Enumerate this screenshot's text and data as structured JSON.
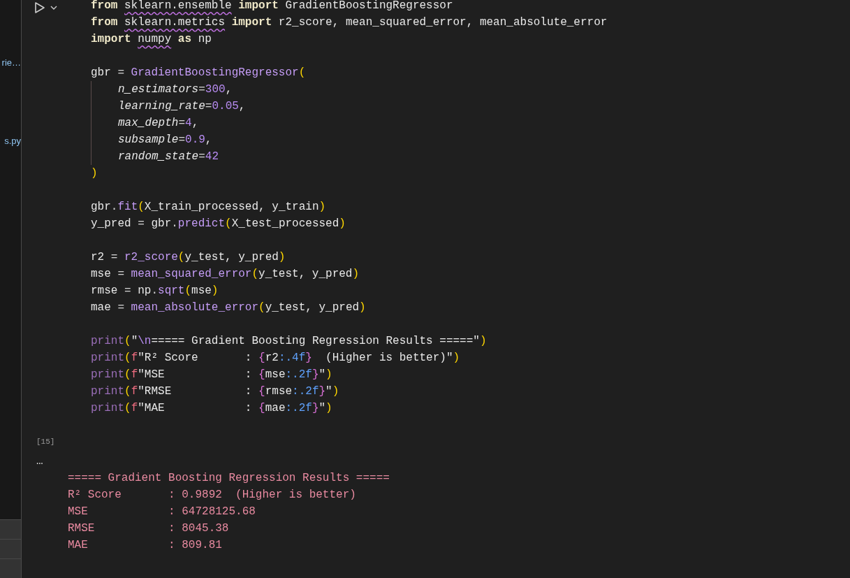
{
  "sidebar": {
    "items": [
      {
        "label": "rie…"
      },
      {
        "label": "s.py"
      }
    ]
  },
  "cell": {
    "code_blocks": [
      [
        {
          "indented": false,
          "tokens": [
            {
              "kind": "kw",
              "text": "from "
            },
            {
              "kind": "modw",
              "text": "sklearn.ensemble"
            },
            {
              "kind": "kw",
              "text": " import"
            },
            {
              "kind": "plain",
              "text": " GradientBoostingRegressor"
            }
          ]
        },
        {
          "indented": false,
          "tokens": [
            {
              "kind": "kw",
              "text": "from "
            },
            {
              "kind": "modw",
              "text": "sklearn.metrics"
            },
            {
              "kind": "kw",
              "text": " import"
            },
            {
              "kind": "plain",
              "text": " r2_score, mean_squared_error, mean_absolute_error"
            }
          ]
        },
        {
          "indented": false,
          "tokens": [
            {
              "kind": "kw",
              "text": "import "
            },
            {
              "kind": "modw",
              "text": "numpy"
            },
            {
              "kind": "kw",
              "text": " as"
            },
            {
              "kind": "plain",
              "text": " np"
            }
          ]
        }
      ],
      [
        {
          "indented": false,
          "tokens": [
            {
              "kind": "plain",
              "text": "gbr "
            },
            {
              "kind": "op",
              "text": "= "
            },
            {
              "kind": "fn",
              "text": "GradientBoostingRegressor"
            },
            {
              "kind": "paren",
              "text": "("
            }
          ]
        },
        {
          "indented": true,
          "tokens": [
            {
              "kind": "param",
              "text": "n_estimators"
            },
            {
              "kind": "op",
              "text": "="
            },
            {
              "kind": "num",
              "text": "300"
            },
            {
              "kind": "plain",
              "text": ","
            }
          ]
        },
        {
          "indented": true,
          "tokens": [
            {
              "kind": "param",
              "text": "learning_rate"
            },
            {
              "kind": "op",
              "text": "="
            },
            {
              "kind": "num",
              "text": "0.05"
            },
            {
              "kind": "plain",
              "text": ","
            }
          ]
        },
        {
          "indented": true,
          "tokens": [
            {
              "kind": "param",
              "text": "max_depth"
            },
            {
              "kind": "op",
              "text": "="
            },
            {
              "kind": "num",
              "text": "4"
            },
            {
              "kind": "plain",
              "text": ","
            }
          ]
        },
        {
          "indented": true,
          "tokens": [
            {
              "kind": "param",
              "text": "subsample"
            },
            {
              "kind": "op",
              "text": "="
            },
            {
              "kind": "num",
              "text": "0.9"
            },
            {
              "kind": "plain",
              "text": ","
            }
          ]
        },
        {
          "indented": true,
          "tokens": [
            {
              "kind": "param",
              "text": "random_state"
            },
            {
              "kind": "op",
              "text": "="
            },
            {
              "kind": "num",
              "text": "42"
            }
          ]
        },
        {
          "indented": false,
          "tokens": [
            {
              "kind": "paren",
              "text": ")"
            }
          ]
        }
      ],
      [
        {
          "indented": false,
          "tokens": [
            {
              "kind": "plain",
              "text": "gbr"
            },
            {
              "kind": "op",
              "text": "."
            },
            {
              "kind": "fn",
              "text": "fit"
            },
            {
              "kind": "paren",
              "text": "("
            },
            {
              "kind": "plain",
              "text": "X_train_processed, y_train"
            },
            {
              "kind": "paren",
              "text": ")"
            }
          ]
        },
        {
          "indented": false,
          "tokens": [
            {
              "kind": "plain",
              "text": "y_pred "
            },
            {
              "kind": "op",
              "text": "= "
            },
            {
              "kind": "plain",
              "text": "gbr"
            },
            {
              "kind": "op",
              "text": "."
            },
            {
              "kind": "fn",
              "text": "predict"
            },
            {
              "kind": "paren",
              "text": "("
            },
            {
              "kind": "plain",
              "text": "X_test_processed"
            },
            {
              "kind": "paren",
              "text": ")"
            }
          ]
        }
      ],
      [
        {
          "indented": false,
          "tokens": [
            {
              "kind": "plain",
              "text": "r2 "
            },
            {
              "kind": "op",
              "text": "= "
            },
            {
              "kind": "fn",
              "text": "r2_score"
            },
            {
              "kind": "paren",
              "text": "("
            },
            {
              "kind": "plain",
              "text": "y_test, y_pred"
            },
            {
              "kind": "paren",
              "text": ")"
            }
          ]
        },
        {
          "indented": false,
          "tokens": [
            {
              "kind": "plain",
              "text": "mse "
            },
            {
              "kind": "op",
              "text": "= "
            },
            {
              "kind": "fn",
              "text": "mean_squared_error"
            },
            {
              "kind": "paren",
              "text": "("
            },
            {
              "kind": "plain",
              "text": "y_test, y_pred"
            },
            {
              "kind": "paren",
              "text": ")"
            }
          ]
        },
        {
          "indented": false,
          "tokens": [
            {
              "kind": "plain",
              "text": "rmse "
            },
            {
              "kind": "op",
              "text": "= "
            },
            {
              "kind": "plain",
              "text": "np"
            },
            {
              "kind": "op",
              "text": "."
            },
            {
              "kind": "fn",
              "text": "sqrt"
            },
            {
              "kind": "paren",
              "text": "("
            },
            {
              "kind": "plain",
              "text": "mse"
            },
            {
              "kind": "paren",
              "text": ")"
            }
          ]
        },
        {
          "indented": false,
          "tokens": [
            {
              "kind": "plain",
              "text": "mae "
            },
            {
              "kind": "op",
              "text": "= "
            },
            {
              "kind": "fn",
              "text": "mean_absolute_error"
            },
            {
              "kind": "paren",
              "text": "("
            },
            {
              "kind": "plain",
              "text": "y_test, y_pred"
            },
            {
              "kind": "paren",
              "text": ")"
            }
          ]
        }
      ],
      [
        {
          "indented": false,
          "tokens": [
            {
              "kind": "builtin",
              "text": "print"
            },
            {
              "kind": "paren",
              "text": "("
            },
            {
              "kind": "str",
              "text": "\""
            },
            {
              "kind": "esc",
              "text": "\\n"
            },
            {
              "kind": "str",
              "text": "===== Gradient Boosting Regression Results =====\""
            },
            {
              "kind": "paren",
              "text": ")"
            }
          ]
        },
        {
          "indented": false,
          "tokens": [
            {
              "kind": "builtin",
              "text": "print"
            },
            {
              "kind": "paren",
              "text": "("
            },
            {
              "kind": "fpre",
              "text": "f"
            },
            {
              "kind": "str",
              "text": "\"R² Score       : "
            },
            {
              "kind": "brace",
              "text": "{"
            },
            {
              "kind": "plain",
              "text": "r2"
            },
            {
              "kind": "fmt",
              "text": ":.4f"
            },
            {
              "kind": "brace",
              "text": "}"
            },
            {
              "kind": "str",
              "text": "  (Higher is better)\""
            },
            {
              "kind": "paren",
              "text": ")"
            }
          ]
        },
        {
          "indented": false,
          "tokens": [
            {
              "kind": "builtin",
              "text": "print"
            },
            {
              "kind": "paren",
              "text": "("
            },
            {
              "kind": "fpre",
              "text": "f"
            },
            {
              "kind": "str",
              "text": "\"MSE            : "
            },
            {
              "kind": "brace",
              "text": "{"
            },
            {
              "kind": "plain",
              "text": "mse"
            },
            {
              "kind": "fmt",
              "text": ":.2f"
            },
            {
              "kind": "brace",
              "text": "}"
            },
            {
              "kind": "str",
              "text": "\""
            },
            {
              "kind": "paren",
              "text": ")"
            }
          ]
        },
        {
          "indented": false,
          "tokens": [
            {
              "kind": "builtin",
              "text": "print"
            },
            {
              "kind": "paren",
              "text": "("
            },
            {
              "kind": "fpre",
              "text": "f"
            },
            {
              "kind": "str",
              "text": "\"RMSE           : "
            },
            {
              "kind": "brace",
              "text": "{"
            },
            {
              "kind": "plain",
              "text": "rmse"
            },
            {
              "kind": "fmt",
              "text": ":.2f"
            },
            {
              "kind": "brace",
              "text": "}"
            },
            {
              "kind": "str",
              "text": "\""
            },
            {
              "kind": "paren",
              "text": ")"
            }
          ]
        },
        {
          "indented": false,
          "tokens": [
            {
              "kind": "builtin",
              "text": "print"
            },
            {
              "kind": "paren",
              "text": "("
            },
            {
              "kind": "fpre",
              "text": "f"
            },
            {
              "kind": "str",
              "text": "\"MAE            : "
            },
            {
              "kind": "brace",
              "text": "{"
            },
            {
              "kind": "plain",
              "text": "mae"
            },
            {
              "kind": "fmt",
              "text": ":.2f"
            },
            {
              "kind": "brace",
              "text": "}"
            },
            {
              "kind": "str",
              "text": "\""
            },
            {
              "kind": "paren",
              "text": ")"
            }
          ]
        }
      ]
    ],
    "execution_count": "[15]",
    "output_menu": "…",
    "output_lines": [
      "===== Gradient Boosting Regression Results =====",
      "R² Score       : 0.9892  (Higher is better)",
      "MSE            : 64728125.68",
      "RMSE           : 8045.38",
      "MAE            : 809.81"
    ]
  }
}
